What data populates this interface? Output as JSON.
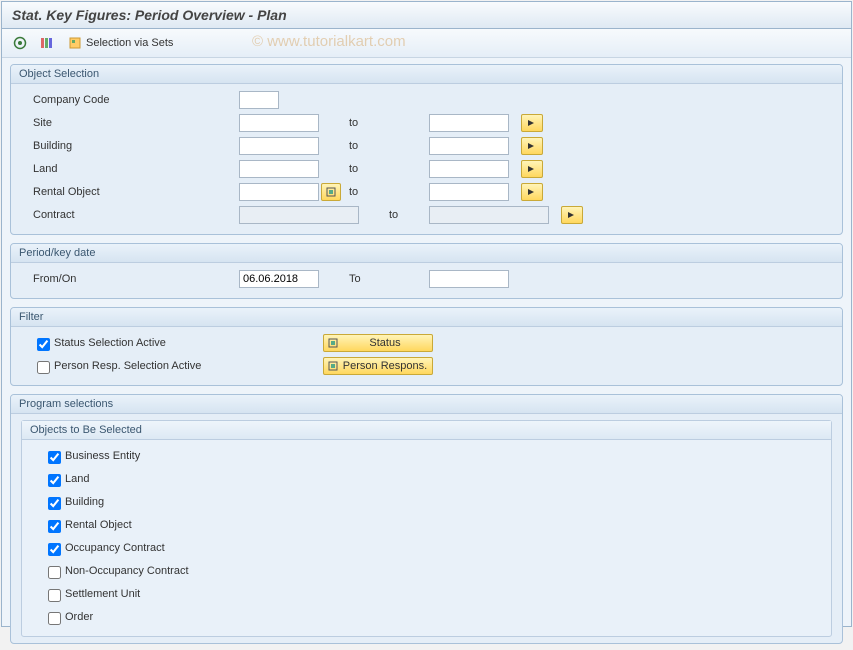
{
  "title": "Stat. Key Figures: Period Overview - Plan",
  "watermark": "© www.tutorialkart.com",
  "toolbar": {
    "selection_via_sets": "Selection via Sets"
  },
  "groups": {
    "object_selection": {
      "title": "Object Selection",
      "company_code": {
        "label": "Company Code",
        "value": ""
      },
      "site": {
        "label": "Site",
        "from": "",
        "to_label": "to",
        "to": ""
      },
      "building": {
        "label": "Building",
        "from": "",
        "to_label": "to",
        "to": ""
      },
      "land": {
        "label": "Land",
        "from": "",
        "to_label": "to",
        "to": ""
      },
      "rental_object": {
        "label": "Rental Object",
        "from": "",
        "to_label": "to",
        "to": ""
      },
      "contract": {
        "label": "Contract",
        "from": "",
        "to_label": "to",
        "to": ""
      }
    },
    "period": {
      "title": "Period/key date",
      "from_on": {
        "label": "From/On",
        "value": "06.06.2018",
        "to_label": "To",
        "to": ""
      }
    },
    "filter": {
      "title": "Filter",
      "status_active": {
        "label": "Status Selection Active",
        "checked": true,
        "btn": "Status"
      },
      "person_active": {
        "label": "Person Resp. Selection Active",
        "checked": false,
        "btn": "Person Respons."
      }
    },
    "program": {
      "title": "Program selections",
      "objects_title": "Objects to Be Selected",
      "items": [
        {
          "label": "Business Entity",
          "checked": true
        },
        {
          "label": "Land",
          "checked": true
        },
        {
          "label": "Building",
          "checked": true
        },
        {
          "label": "Rental Object",
          "checked": true
        },
        {
          "label": "Occupancy Contract",
          "checked": true
        },
        {
          "label": "Non-Occupancy Contract",
          "checked": false
        },
        {
          "label": "Settlement Unit",
          "checked": false
        },
        {
          "label": "Order",
          "checked": false
        }
      ]
    }
  }
}
